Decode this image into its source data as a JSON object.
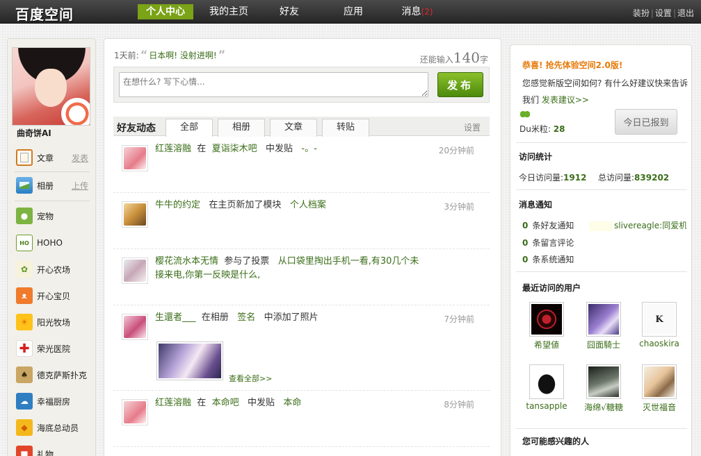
{
  "topbar": {
    "logo": "百度空间",
    "nav": [
      {
        "label": "个人中心",
        "active": true
      },
      {
        "label": "我的主页",
        "active": false
      },
      {
        "label": "好友",
        "active": false
      },
      {
        "label": "应用",
        "active": false
      },
      {
        "label": "消息",
        "active": false
      }
    ],
    "message_count": "(2)",
    "right_links": [
      "装扮",
      "设置",
      "退出"
    ]
  },
  "profile": {
    "username": "曲奇饼AI"
  },
  "sidebar": {
    "items": [
      {
        "label": "文章",
        "action": "发表",
        "icon": "notebook-icon"
      },
      {
        "label": "相册",
        "action": "上传",
        "icon": "photo-icon"
      },
      {
        "label": "宠物",
        "icon": "panda-icon"
      },
      {
        "label": "HOHO",
        "icon": "hoho-icon"
      },
      {
        "label": "开心农场",
        "icon": "sprout-icon"
      },
      {
        "label": "开心宝贝",
        "icon": "bunny-icon"
      },
      {
        "label": "阳光牧场",
        "icon": "sun-icon"
      },
      {
        "label": "荣光医院",
        "icon": "red-cross-icon"
      },
      {
        "label": "德克萨斯扑克",
        "icon": "poker-icon"
      },
      {
        "label": "幸福厨房",
        "icon": "chef-hat-icon"
      },
      {
        "label": "海底总动员",
        "icon": "fish-icon"
      },
      {
        "label": "礼物",
        "icon": "gift-icon"
      }
    ]
  },
  "status": {
    "time": "1天前:",
    "message": "日本啊! 没射进啊!",
    "remain_prefix": "还能输入",
    "remain_count": "140",
    "remain_suffix": "字"
  },
  "post_box": {
    "placeholder": "在想什么? 写下心情...",
    "button": "发布"
  },
  "feed_tabs": {
    "title": "好友动态",
    "tabs": [
      "全部",
      "相册",
      "文章",
      "转贴"
    ],
    "active_index": 0,
    "setting": "设置"
  },
  "feed": [
    {
      "user": "红莲溶融",
      "parts": [
        "在",
        "夏诣柒木吧",
        "中发贴",
        "-。-"
      ],
      "time": "20分钟前"
    },
    {
      "user": "牛牛的约定",
      "parts": [
        "在主页新加了模块",
        "个人档案"
      ],
      "time": "3分钟前"
    },
    {
      "user": "樱花流水本无情",
      "parts": [
        "参与了投票",
        "从口袋里掏出手机一看,有30几个未接来电,你第一反映是什么,"
      ],
      "time": ""
    },
    {
      "user": "生還者___",
      "parts": [
        "在相册",
        "签名",
        "中添加了照片"
      ],
      "time": "7分钟前",
      "view_all": "查看全部>>"
    },
    {
      "user": "红莲溶融",
      "parts": [
        "在",
        "本命吧",
        "中发贴",
        "本命"
      ],
      "time": "8分钟前"
    }
  ],
  "right": {
    "congrats": "恭喜! 抢先体验空间2.0版!",
    "feedback_text": "您感觉新版空间如何? 有什么好建议快来告诉我们",
    "feedback_link": "发表建议>>",
    "du_label": "Du米粒:",
    "du_value": "28",
    "checkin": "今日已报到",
    "stats_title": "访问统计",
    "today_label": "今日访问量:",
    "today_value": "1912",
    "total_label": "总访问量:",
    "total_value": "839202",
    "notice_title": "消息通知",
    "notices": [
      {
        "count": "0",
        "label": "条好友通知"
      },
      {
        "count": "0",
        "label": "条留言评论"
      },
      {
        "count": "0",
        "label": "条系统通知"
      }
    ],
    "notice_extra": "slivereagle:同爱机",
    "visitors_title": "最近访问的用户",
    "visitors": [
      "希望値",
      "囧面騎士",
      "chaoskira",
      "tansapple",
      "海绵√糖糖",
      "灭世福音"
    ],
    "interest_title": "您可能感兴趣的人"
  }
}
